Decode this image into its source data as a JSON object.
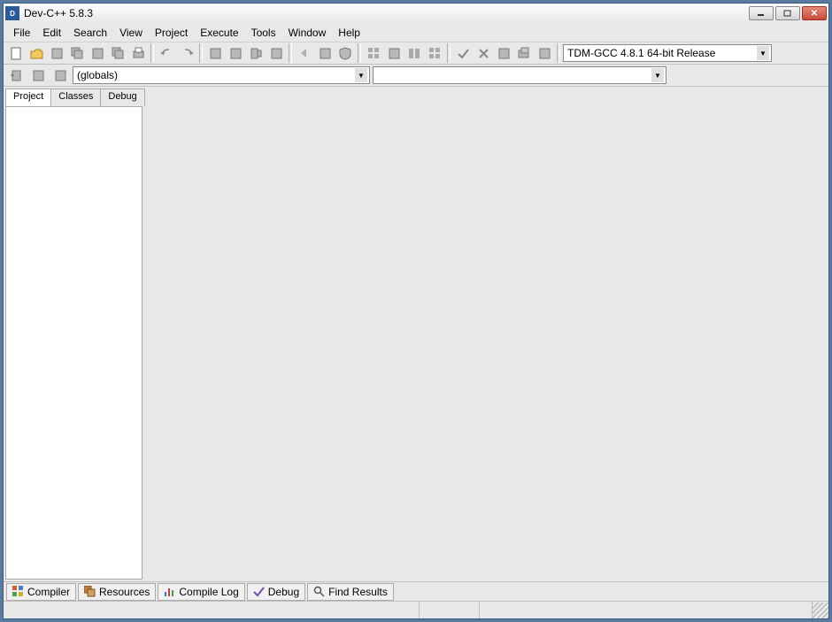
{
  "window": {
    "title": "Dev-C++ 5.8.3"
  },
  "menu": {
    "items": [
      "File",
      "Edit",
      "Search",
      "View",
      "Project",
      "Execute",
      "Tools",
      "Window",
      "Help"
    ]
  },
  "toolbar": {
    "buttons": [
      "new",
      "open",
      "save",
      "save-all",
      "close",
      "close-all",
      "print",
      "undo",
      "redo",
      "cut",
      "copy",
      "paste",
      "find",
      "replace",
      "find-in-files",
      "toggle-bookmark",
      "prev-bookmark",
      "goto",
      "back",
      "forward",
      "shield",
      "grid1",
      "grid2",
      "grid3",
      "grid4",
      "check",
      "cross",
      "compile-btn",
      "run",
      "compile-run"
    ],
    "compiler_selected": "TDM-GCC 4.8.1 64-bit Release"
  },
  "toolbar2": {
    "buttons": [
      "insert",
      "toggle",
      "goto2"
    ],
    "scope_selected": "(globals)",
    "member_selected": ""
  },
  "side_tabs": [
    "Project",
    "Classes",
    "Debug"
  ],
  "active_side_tab": 0,
  "bottom_tabs": [
    {
      "icon": "grid",
      "label": "Compiler"
    },
    {
      "icon": "stack",
      "label": "Resources"
    },
    {
      "icon": "bar",
      "label": "Compile Log"
    },
    {
      "icon": "check",
      "label": "Debug"
    },
    {
      "icon": "search",
      "label": "Find Results"
    }
  ]
}
